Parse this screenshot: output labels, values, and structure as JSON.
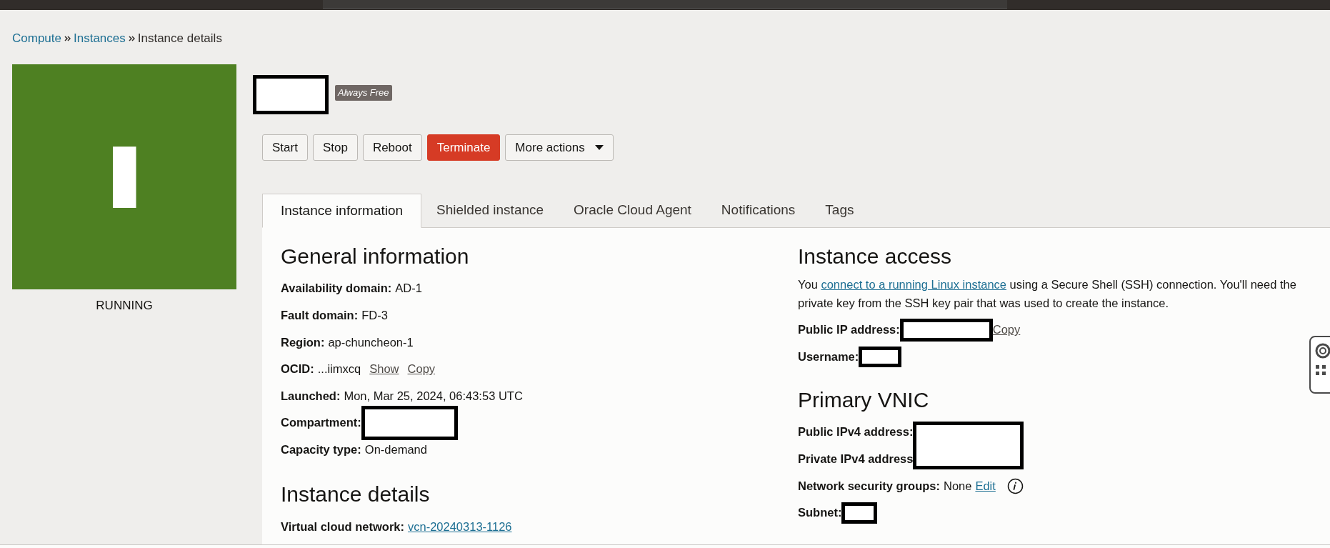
{
  "breadcrumb": [
    {
      "label": "Compute",
      "kind": "link"
    },
    {
      "label": "Instances",
      "kind": "link"
    },
    {
      "label": "Instance details",
      "kind": "current"
    }
  ],
  "instance": {
    "letter": "I",
    "state": "RUNNING",
    "badge": "Always Free"
  },
  "actions": [
    {
      "label": "Start",
      "kind": "default"
    },
    {
      "label": "Stop",
      "kind": "default"
    },
    {
      "label": "Reboot",
      "kind": "default"
    },
    {
      "label": "Terminate",
      "kind": "danger"
    },
    {
      "label": "More actions",
      "kind": "menu"
    }
  ],
  "tabs": [
    {
      "label": "Instance information",
      "selected": true
    },
    {
      "label": "Shielded instance",
      "selected": false
    },
    {
      "label": "Oracle Cloud Agent",
      "selected": false
    },
    {
      "label": "Notifications",
      "selected": false
    },
    {
      "label": "Tags",
      "selected": false
    }
  ],
  "left": [
    {
      "heading": "General information",
      "rows": [
        {
          "kind": "text",
          "label": "Availability domain:",
          "value": "AD-1"
        },
        {
          "kind": "text",
          "label": "Fault domain:",
          "value": "FD-3"
        },
        {
          "kind": "text",
          "label": "Region:",
          "value": "ap-chuncheon-1"
        },
        {
          "kind": "text",
          "label": "OCID:",
          "value": "...iimxcq",
          "actions": [
            {
              "label": "Show",
              "kind": "muted"
            },
            {
              "label": "Copy",
              "kind": "muted"
            }
          ]
        },
        {
          "kind": "text",
          "label": "Launched:",
          "value": "Mon, Mar 25, 2024, 06:43:53 UTC"
        },
        {
          "kind": "redacted",
          "label": "Compartment:"
        },
        {
          "kind": "text",
          "label": "Capacity type:",
          "value": "On-demand"
        }
      ]
    },
    {
      "heading": "Instance details",
      "rows": [
        {
          "kind": "link",
          "label": "Virtual cloud network:",
          "value": "vcn-20240313-1126"
        }
      ]
    }
  ],
  "access": {
    "heading": "Instance access",
    "intro_before": "You ",
    "intro_link": "connect to a running Linux instance",
    "intro_after": " using a Secure Shell (SSH) connection. You'll need the private key from the SSH key pair that was used to create the instance.",
    "rows": [
      {
        "kind": "redacted",
        "label": "Public IP address:",
        "actions": [
          {
            "label": "Copy",
            "kind": "muted"
          }
        ]
      },
      {
        "kind": "redacted",
        "label": "Username:"
      }
    ]
  },
  "vnic": {
    "heading": "Primary VNIC",
    "redacted_labels": [
      "Public IPv4 address:",
      "Private IPv4 address"
    ],
    "rows": [
      {
        "kind": "text",
        "label": "Network security groups:",
        "value": "None",
        "actions": [
          {
            "label": "Edit",
            "kind": "link"
          }
        ],
        "info": true
      },
      {
        "kind": "redacted",
        "label": "Subnet:"
      }
    ]
  }
}
